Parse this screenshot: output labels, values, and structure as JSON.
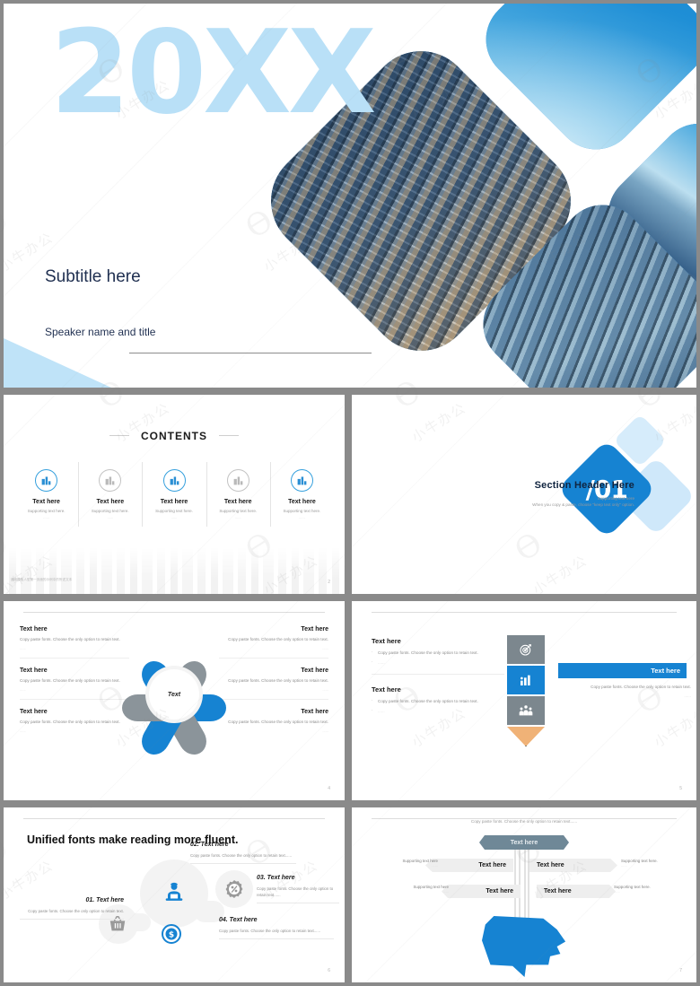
{
  "theme": {
    "accent_blue": "#1683d2",
    "light_blue": "#bfe3f8",
    "pale_blue": "#d6ecfb",
    "grey": "#7c878e",
    "tip_orange": "#f0b277",
    "navy_text": "#1f2f50",
    "sheet_bg": "#8a8a8a"
  },
  "hero": {
    "year": "20XX",
    "subtitle": "Subtitle here",
    "speaker": "Speaker name and title"
  },
  "toc": {
    "title": "CONTENTS",
    "footer_note": "通用模板人型第一页面的示例中的所述文本",
    "page": "2",
    "items": [
      {
        "icon": "buildings-icon",
        "accent": "blue",
        "heading": "Text here",
        "support": "Supporting text here.",
        "sub": "......"
      },
      {
        "icon": "buildings-icon",
        "accent": "grey",
        "heading": "Text here",
        "support": "Supporting text here.",
        "sub": "......"
      },
      {
        "icon": "buildings-icon",
        "accent": "blue",
        "heading": "Text here",
        "support": "Supporting text here.",
        "sub": "......"
      },
      {
        "icon": "buildings-icon",
        "accent": "grey",
        "heading": "Text here",
        "support": "Supporting text here.",
        "sub": "......"
      },
      {
        "icon": "buildings-icon",
        "accent": "blue",
        "heading": "Text here",
        "support": "Supporting text here.",
        "sub": "......"
      }
    ]
  },
  "section": {
    "heading": "Section Header Here",
    "support_1": "Supporting text here",
    "support_2": "When you copy & paste, choose \"keep text only\" option.",
    "number": "/01"
  },
  "cycle": {
    "center_label": "Text",
    "page": "4",
    "left": [
      {
        "heading": "Text here",
        "body": "Copy paste fonts. Choose the only option to retain text.",
        "meta": "......"
      },
      {
        "heading": "Text here",
        "body": "Copy paste fonts. Choose the only option to retain text.",
        "meta": "......"
      },
      {
        "heading": "Text here",
        "body": "Copy paste fonts. Choose the only option to retain text.",
        "meta": "......"
      }
    ],
    "right": [
      {
        "heading": "Text here",
        "body": "Copy paste fonts. Choose the only option to retain text.",
        "meta": "......"
      },
      {
        "heading": "Text here",
        "body": "Copy paste fonts. Choose the only option to retain text.",
        "meta": "......"
      },
      {
        "heading": "Text here",
        "body": "Copy paste fonts. Choose the only option to retain text.",
        "meta": "......"
      }
    ],
    "petal_icons": [
      "calendar-icon",
      "person-icon",
      "key-icon",
      "clipboard-icon",
      "lock-icon",
      "location-pin-icon"
    ]
  },
  "pencil": {
    "page": "5",
    "blocks": [
      {
        "heading": "Text here",
        "bullet_1": "Copy paste fonts. Choose the only option to retain text.",
        "bullet_2": "......"
      },
      {
        "heading": "Text here",
        "bullet_1": "Copy paste fonts. Choose the only option to retain text.",
        "bullet_2": "......"
      }
    ],
    "segments": [
      {
        "icon": "target-icon",
        "color": "grey"
      },
      {
        "icon": "bar-chart-icon",
        "color": "blue"
      },
      {
        "icon": "people-group-icon",
        "color": "grey"
      }
    ],
    "bar_label": "Text here",
    "bar_bullet_1": "Copy paste fonts. Choose the only option to retain text.",
    "bar_bullet_2": "......"
  },
  "flow": {
    "title": "Unified fonts make reading more fluent.",
    "page": "6",
    "items": [
      {
        "heading": "01. Text here",
        "body": "Copy paste fonts. Choose the only option to retain text.",
        "icon": "shopping-basket-icon",
        "accent": "grey"
      },
      {
        "heading": "02. Text here",
        "body": "Copy paste fonts. Choose the only option to retain text......",
        "icon": "person-laptop-icon",
        "accent": "blue"
      },
      {
        "heading": "03. Text here",
        "body": "Copy paste fonts. Choose the only option to retain text......",
        "icon": "percent-gear-icon",
        "accent": "grey"
      },
      {
        "heading": "04. Text here",
        "body": "Copy paste fonts. Choose the only option to retain text......",
        "icon": "dollar-coin-icon",
        "accent": "blue"
      }
    ]
  },
  "brain": {
    "page": "7",
    "top_note": "Copy paste fonts. Choose the only option to retain text......",
    "header_label": "Text here",
    "rows": [
      {
        "side": "left",
        "label": "Text here",
        "support": "Supporting text here",
        "meta": "......"
      },
      {
        "side": "right",
        "label": "Text here",
        "support": "Supporting text here.",
        "meta": "......"
      },
      {
        "side": "left",
        "label": "Text here",
        "support": "Supporting text here",
        "meta": "......"
      },
      {
        "side": "right",
        "label": "Text here",
        "support": "Supporting text here.",
        "meta": "......"
      }
    ],
    "head_icon": "human-head-icon"
  }
}
